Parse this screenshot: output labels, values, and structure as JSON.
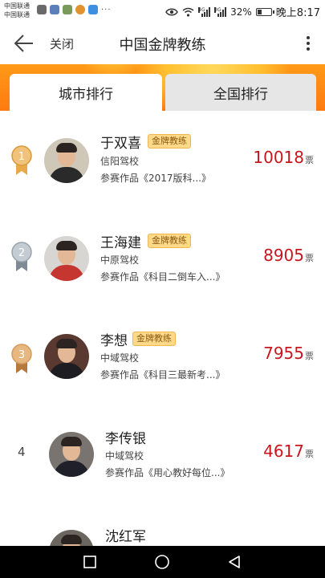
{
  "status_bar": {
    "carrier_1": "中国联通",
    "carrier_2": "中国联通",
    "more_dots": "···",
    "battery_percent": "32%",
    "time": "晚上8:17",
    "network_1": "4G",
    "network_2": "3G"
  },
  "app_bar": {
    "close_label": "关闭",
    "title": "中国金牌教练"
  },
  "tabs": [
    {
      "label": "城市排行",
      "active": true
    },
    {
      "label": "全国排行",
      "active": false
    }
  ],
  "coaches": [
    {
      "rank": "1",
      "name": "于双喜",
      "badge": "金牌教练",
      "school": "信阳驾校",
      "work": "参赛作品《2017版科...》",
      "votes": "10018",
      "unit": "票"
    },
    {
      "rank": "2",
      "name": "王海建",
      "badge": "金牌教练",
      "school": "中原驾校",
      "work": "参赛作品《科目二倒车入...》",
      "votes": "8905",
      "unit": "票"
    },
    {
      "rank": "3",
      "name": "李想",
      "badge": "金牌教练",
      "school": "中域驾校",
      "work": "参赛作品《科目三最新考...》",
      "votes": "7955",
      "unit": "票"
    },
    {
      "rank": "4",
      "name": "李传银",
      "badge": "",
      "school": "中域驾校",
      "work": "参赛作品《用心教好每位...》",
      "votes": "4617",
      "unit": "票"
    },
    {
      "rank": "",
      "name": "沈红军",
      "badge": "",
      "school": "",
      "work": "",
      "votes": "",
      "unit": ""
    }
  ],
  "colors": {
    "accent_orange": "#ff8a14",
    "vote_red": "#c8161d",
    "gold": "#e8a94a",
    "silver": "#9aa4ad",
    "bronze": "#d89a5a"
  },
  "icons": {
    "back": "back-arrow-icon",
    "more": "more-vertical-icon",
    "nav_back": "nav-back-icon",
    "nav_home": "nav-home-icon",
    "nav_recents": "nav-recents-icon"
  }
}
